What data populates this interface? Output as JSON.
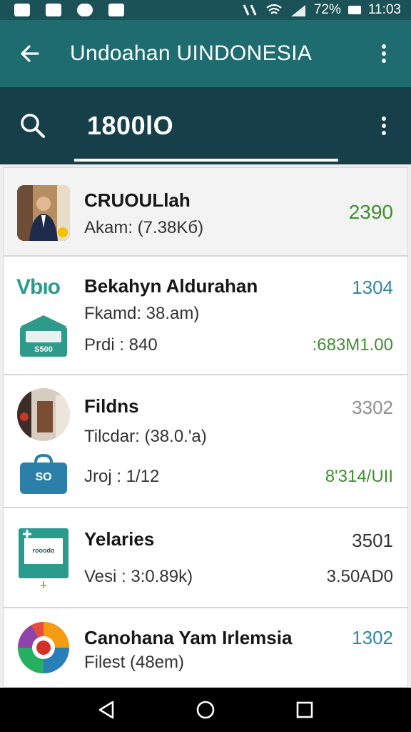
{
  "status_bar": {
    "battery": "72%",
    "time": "11:03"
  },
  "app_bar": {
    "title": "Undoahan UINDONESIA"
  },
  "search": {
    "value": "1800lO"
  },
  "items": [
    {
      "name": "CRUOULlah",
      "sub": "Akam: (7.38Kб)",
      "value": "2390",
      "value_color": "#3f8f2f"
    },
    {
      "name": "Bekahyn Aldurahan",
      "sub": "Fkamd: 38.am)",
      "meta": "Prdi : 840",
      "value": "1304",
      "value_color": "#2f87a6",
      "value2": ":683M1.00",
      "value2_color": "#3f8f2f",
      "logo_text": "Vbıo",
      "badge_text": "S500"
    },
    {
      "name": "Fildns",
      "sub": "Tilcdar: (38.0.'a)",
      "meta": "Jroj : 1/12",
      "value": "3302",
      "value_color": "#8e8e8e",
      "value2": "8'314/UII",
      "value2_color": "#3f8f2f",
      "badge_text": "SO"
    },
    {
      "name": "Yelaries",
      "sub": "Vesi : 3:0.89k)",
      "value": "3501",
      "value_color": "#333333",
      "value2": "3.50AD0",
      "value2_color": "#333333",
      "badge_text": "rooodo"
    },
    {
      "name": "Canohana Yam Irlemsia",
      "sub": "Filest (48em)",
      "value": "1302",
      "value_color": "#2f87a6"
    }
  ],
  "icons": {
    "back": "arrow-left-icon",
    "more": "more-vertical-icon",
    "search": "search-icon",
    "nav_back": "triangle-back-icon",
    "nav_home": "circle-home-icon",
    "nav_recents": "square-recents-icon"
  }
}
